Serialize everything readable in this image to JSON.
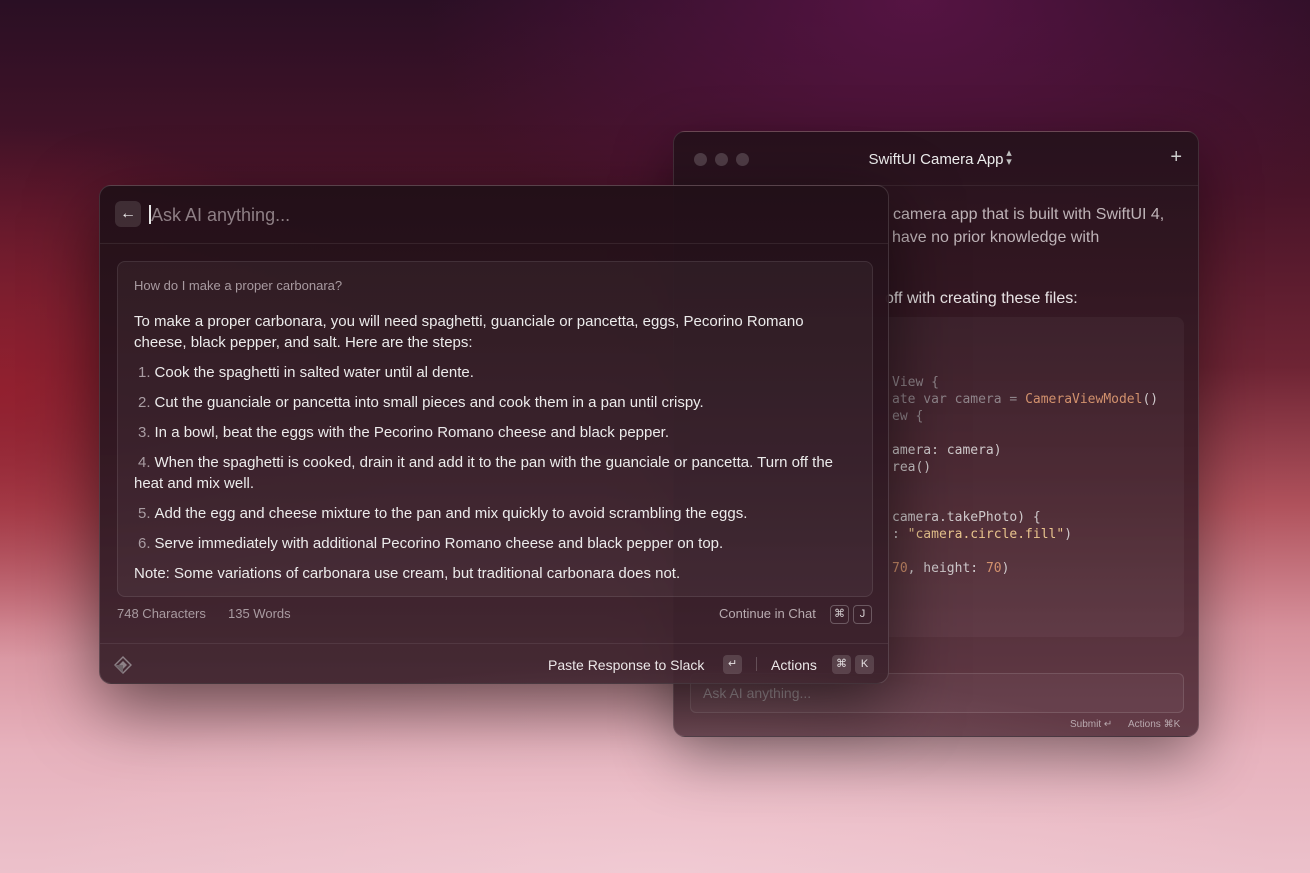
{
  "background_window": {
    "title": "SwiftUI Camera App",
    "new_chat_label": "+",
    "text_lines": [
      "camera app that is built with SwiftUI 4,",
      "have no prior knowledge with"
    ],
    "files_line": "off with creating these files:",
    "code_lines": [
      {
        "a": "View {",
        "b": ""
      },
      {
        "a": "ate var camera = ",
        "b": "CameraViewModel",
        "c": "()"
      },
      {
        "a": "ew {",
        "b": ""
      },
      {
        "a": "amera: camera)",
        "b": ""
      },
      {
        "a": "rea()",
        "b": ""
      },
      {
        "a": "camera.takePhoto) {",
        "b": ""
      },
      {
        "a": ": ",
        "b": "\"camera.circle.fill\"",
        "c": ")"
      },
      {
        "a": "70",
        "b": ", height: ",
        "c": "70",
        "d": ")"
      }
    ],
    "input_placeholder": "Ask AI anything...",
    "footer_submit": "Submit ↵",
    "footer_actions": "Actions ⌘K"
  },
  "panel": {
    "search_placeholder": "Ask AI anything...",
    "question": "How do I make a proper carbonara?",
    "intro": "To make a proper carbonara, you will need spaghetti, guanciale or pancetta, eggs, Pecorino Romano cheese, black pepper, and salt. Here are the steps:",
    "steps": [
      {
        "num": "1.",
        "text": "Cook the spaghetti in salted water until al dente."
      },
      {
        "num": "2.",
        "text": "Cut the guanciale or pancetta into small pieces and cook them in a pan until crispy."
      },
      {
        "num": "3.",
        "text": "In a bowl, beat the eggs with the Pecorino Romano cheese and black pepper."
      },
      {
        "num": "4.",
        "text": "When the spaghetti is cooked, drain it and add it to the pan with the guanciale or pancetta. Turn off the heat and mix well."
      },
      {
        "num": "5.",
        "text": "Add the egg and cheese mixture to the pan and mix quickly to avoid scrambling the eggs."
      },
      {
        "num": "6.",
        "text": "Serve immediately with additional Pecorino Romano cheese and black pepper on top."
      }
    ],
    "note": "Note: Some variations of carbonara use cream, but traditional carbonara does not.",
    "characters": "748 Characters",
    "words": "135 Words",
    "continue_label": "Continue in Chat",
    "continue_keys": [
      "⌘",
      "J"
    ],
    "paste_label": "Paste Response to Slack",
    "paste_key": "↵",
    "actions_label": "Actions",
    "actions_keys": [
      "⌘",
      "K"
    ]
  },
  "icons": {
    "back": "arrow-left-icon",
    "logo": "ai-logo-icon",
    "chevron": "chevron-up-down-icon"
  }
}
